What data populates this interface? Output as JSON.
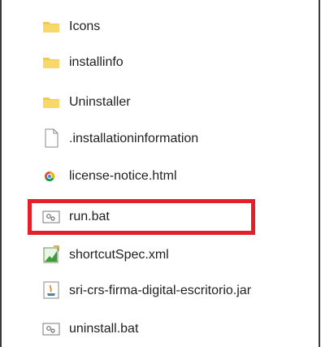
{
  "explorer": {
    "files": [
      {
        "name": "Icons",
        "icon": "folder-icon"
      },
      {
        "name": "installinfo",
        "icon": "folder-icon"
      },
      {
        "name": "Uninstaller",
        "icon": "folder-icon"
      },
      {
        "name": ".installationinformation",
        "icon": "blank-file-icon"
      },
      {
        "name": "license-notice.html",
        "icon": "browser-html-icon"
      },
      {
        "name": "run.bat",
        "icon": "batch-file-icon"
      },
      {
        "name": "shortcutSpec.xml",
        "icon": "xml-file-icon"
      },
      {
        "name": "sri-crs-firma-digital-escritorio.jar",
        "icon": "java-jar-icon"
      },
      {
        "name": "uninstall.bat",
        "icon": "batch-file-icon"
      }
    ]
  },
  "colors": {
    "highlight": "#e0202a",
    "folder": "#f2c94c",
    "text": "#1f1f1f"
  }
}
